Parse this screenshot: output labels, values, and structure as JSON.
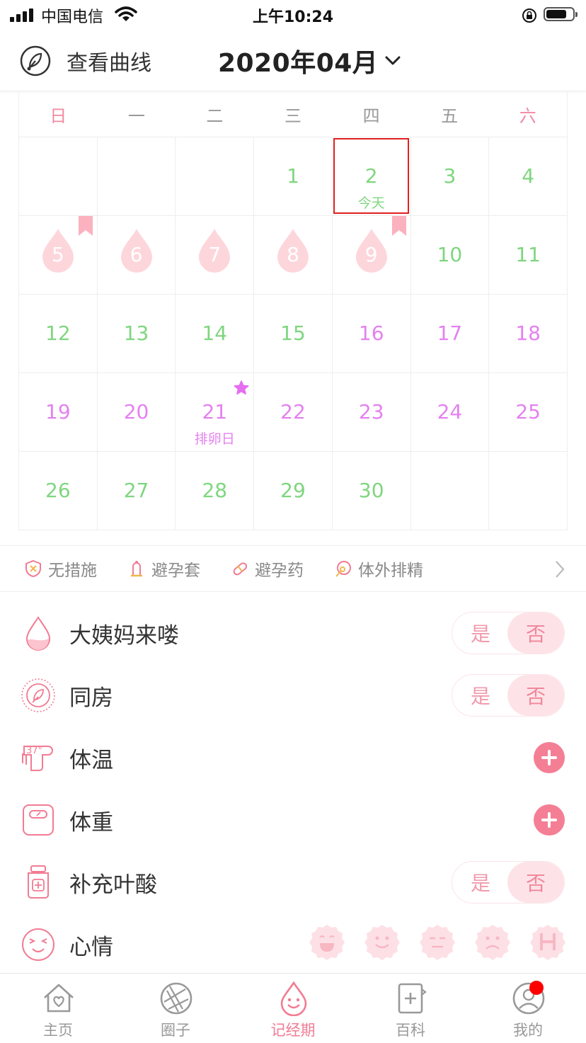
{
  "status_bar": {
    "carrier": "中国电信",
    "time": "上午10:24"
  },
  "header": {
    "curve_label": "查看曲线",
    "month": "2020年04月"
  },
  "calendar": {
    "weekdays": [
      "日",
      "一",
      "二",
      "三",
      "四",
      "五",
      "六"
    ],
    "days": [
      {
        "d": ""
      },
      {
        "d": ""
      },
      {
        "d": ""
      },
      {
        "d": "1",
        "c": "green"
      },
      {
        "d": "2",
        "c": "green",
        "sub": "今天",
        "today": true
      },
      {
        "d": "3",
        "c": "green"
      },
      {
        "d": "4",
        "c": "green"
      },
      {
        "d": "5",
        "c": "period",
        "bookmark": true
      },
      {
        "d": "6",
        "c": "period"
      },
      {
        "d": "7",
        "c": "period"
      },
      {
        "d": "8",
        "c": "period"
      },
      {
        "d": "9",
        "c": "period",
        "bookmark": true
      },
      {
        "d": "10",
        "c": "green"
      },
      {
        "d": "11",
        "c": "green"
      },
      {
        "d": "12",
        "c": "green"
      },
      {
        "d": "13",
        "c": "green"
      },
      {
        "d": "14",
        "c": "green"
      },
      {
        "d": "15",
        "c": "green"
      },
      {
        "d": "16",
        "c": "violet"
      },
      {
        "d": "17",
        "c": "violet"
      },
      {
        "d": "18",
        "c": "violet"
      },
      {
        "d": "19",
        "c": "violet"
      },
      {
        "d": "20",
        "c": "violet"
      },
      {
        "d": "21",
        "c": "violet",
        "sub": "排卵日",
        "star": true
      },
      {
        "d": "22",
        "c": "violet"
      },
      {
        "d": "23",
        "c": "violet"
      },
      {
        "d": "24",
        "c": "violet"
      },
      {
        "d": "25",
        "c": "violet"
      },
      {
        "d": "26",
        "c": "green"
      },
      {
        "d": "27",
        "c": "green"
      },
      {
        "d": "28",
        "c": "green"
      },
      {
        "d": "29",
        "c": "green"
      },
      {
        "d": "30",
        "c": "green"
      },
      {
        "d": ""
      },
      {
        "d": ""
      }
    ]
  },
  "contraception": {
    "items": [
      "无措施",
      "避孕套",
      "避孕药",
      "体外排精"
    ]
  },
  "records": {
    "period": {
      "label": "大姨妈来喽",
      "yes": "是",
      "no": "否"
    },
    "intimacy": {
      "label": "同房",
      "yes": "是",
      "no": "否"
    },
    "temperature": {
      "label": "体温",
      "icon_text": "37°"
    },
    "weight": {
      "label": "体重"
    },
    "folic": {
      "label": "补充叶酸",
      "yes": "是",
      "no": "否"
    },
    "mood": {
      "label": "心情"
    }
  },
  "tabs": [
    {
      "label": "主页",
      "icon": "home-heart-icon"
    },
    {
      "label": "圈子",
      "icon": "aperture-icon"
    },
    {
      "label": "记经期",
      "icon": "drop-smile-icon",
      "active": true
    },
    {
      "label": "百科",
      "icon": "book-plus-icon"
    },
    {
      "label": "我的",
      "icon": "user-icon",
      "badge": true
    }
  ],
  "colors": {
    "accent": "#f17c93",
    "green": "#7fd67f",
    "violet": "#e481f0",
    "period": "#fdd6dc",
    "today_border": "#e02020"
  }
}
